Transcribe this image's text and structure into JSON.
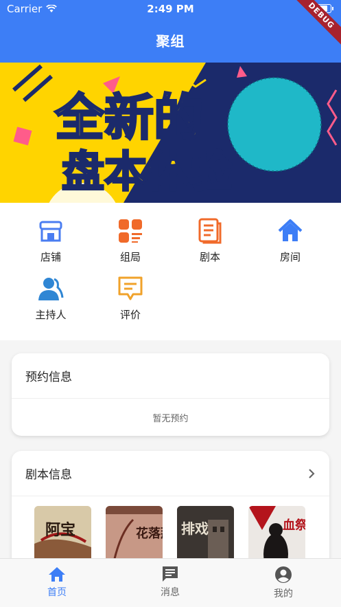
{
  "status_bar": {
    "carrier": "Carrier",
    "time": "2:49 PM"
  },
  "app_bar": {
    "title": "聚组",
    "debug_badge": "DEBUG"
  },
  "banner": {
    "text_line1": "全新的",
    "text_line2": "盘本体验"
  },
  "menu": [
    {
      "label": "店铺",
      "icon": "store-icon",
      "color": "#4a7df1"
    },
    {
      "label": "组局",
      "icon": "grid-icon",
      "color": "#f06a2a"
    },
    {
      "label": "剧本",
      "icon": "script-icon",
      "color": "#f06a2a"
    },
    {
      "label": "房间",
      "icon": "home-icon",
      "color": "#3d7ef6"
    },
    {
      "label": "主持人",
      "icon": "host-icon",
      "color": "#2f86d4"
    },
    {
      "label": "评价",
      "icon": "comment-icon",
      "color": "#f0a22a"
    }
  ],
  "reservation": {
    "title": "预约信息",
    "empty_text": "暂无预约"
  },
  "scripts": {
    "title": "剧本信息",
    "covers": [
      {
        "title": "阿宝"
      },
      {
        "title": "花落那"
      },
      {
        "title": "排戏"
      },
      {
        "title": "血祭"
      }
    ]
  },
  "tabbar": [
    {
      "label": "首页",
      "icon": "home-tab-icon",
      "active": true
    },
    {
      "label": "消息",
      "icon": "message-tab-icon",
      "active": false
    },
    {
      "label": "我的",
      "icon": "profile-tab-icon",
      "active": false
    }
  ],
  "colors": {
    "primary": "#3d7ef6",
    "banner_yellow": "#ffd400",
    "banner_navy": "#1b2a6b"
  }
}
